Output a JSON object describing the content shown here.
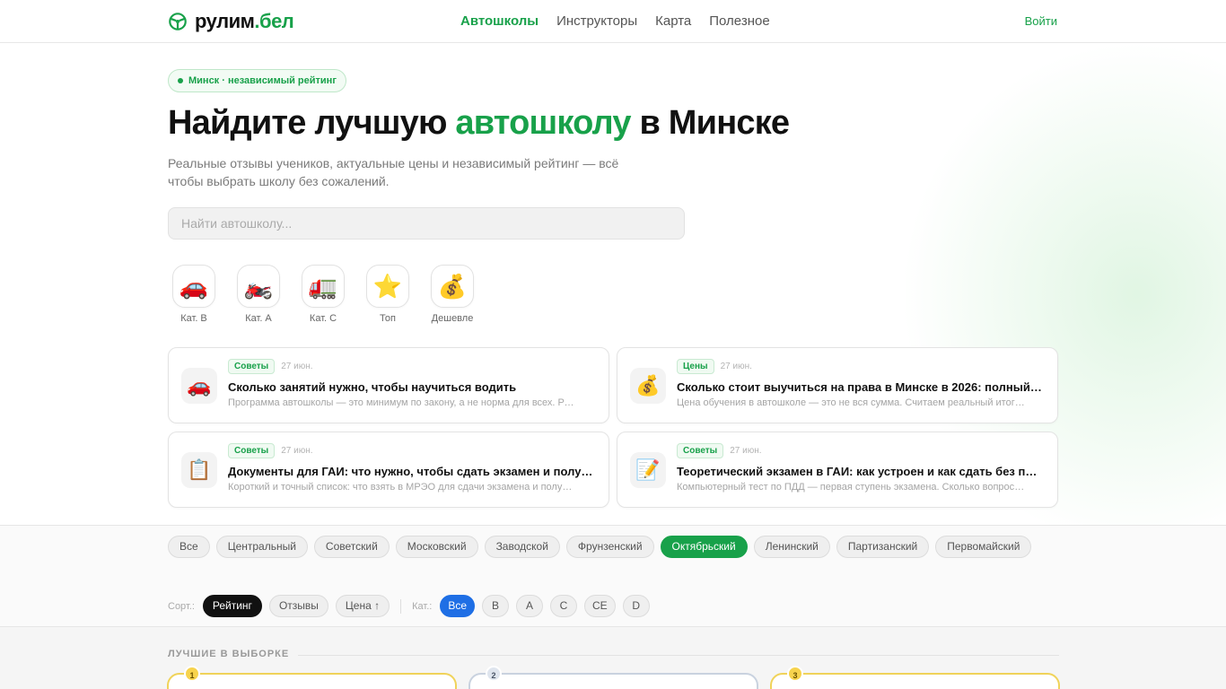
{
  "header": {
    "logo_main": "рулим",
    "logo_accent": ".бел",
    "nav": [
      "Автошколы",
      "Инструкторы",
      "Карта",
      "Полезное"
    ],
    "login": "Войти"
  },
  "hero": {
    "badge": "Минск · независимый рейтинг",
    "title_before": "Найдите лучшую ",
    "title_highlight": "автошколу",
    "title_after": " в Минске",
    "subtitle": "Реальные отзывы учеников, актуальные цены и независимый рейтинг — всё чтобы выбрать школу без сожалений.",
    "search_placeholder": "Найти автошколу..."
  },
  "categories": [
    {
      "icon": "🚗",
      "label": "Кат. B",
      "icon_name": "car-icon"
    },
    {
      "icon": "🏍️",
      "label": "Кат. A",
      "icon_name": "motorcycle-icon"
    },
    {
      "icon": "🚛",
      "label": "Кат. C",
      "icon_name": "truck-icon"
    },
    {
      "icon": "⭐",
      "label": "Топ",
      "icon_name": "star-icon"
    },
    {
      "icon": "💰",
      "label": "Дешевле",
      "icon_name": "money-bag-icon"
    }
  ],
  "articles": [
    {
      "icon": "🚗",
      "tag": "Советы",
      "date": "27 июн.",
      "title": "Сколько занятий нужно, чтобы научиться водить",
      "desc": "Программа автошколы — это минимум по закону, а не норма для всех. Разбираем, сколько"
    },
    {
      "icon": "💰",
      "tag": "Цены",
      "date": "27 июн.",
      "title": "Сколько стоит выучиться на права в Минске в 2026: полный разбор",
      "desc": "Цена обучения в автошколе — это не вся сумма. Считаем реальный итог со всеми расходами"
    },
    {
      "icon": "📋",
      "tag": "Советы",
      "date": "27 июн.",
      "title": "Документы для ГАИ: что нужно, чтобы сдать экзамен и получить права",
      "desc": "Короткий и точный список: что взять в МРЭО для сдачи экзамена и получения прав"
    },
    {
      "icon": "📝",
      "tag": "Советы",
      "date": "27 июн.",
      "title": "Теоретический экзамен в ГАИ: как устроен и как сдать без пересдач",
      "desc": "Компьютерный тест по ПДД — первая ступень экзамена. Сколько вопросов и ошибок допустимо"
    }
  ],
  "districts": [
    "Все",
    "Центральный",
    "Советский",
    "Московский",
    "Заводской",
    "Фрунзенский",
    "Октябрьский",
    "Ленинский",
    "Партизанский",
    "Первомайский"
  ],
  "active_district": "Октябрьский",
  "sort": {
    "label": "Сорт.:",
    "options": [
      "Рейтинг",
      "Отзывы",
      "Цена ↑"
    ],
    "active": "Рейтинг",
    "cat_label": "Кат.:",
    "cat_options": [
      "Все",
      "B",
      "A",
      "C",
      "CE",
      "D"
    ],
    "cat_active": "Все"
  },
  "best": {
    "heading": "ЛУЧШИЕ В ВЫБОРКЕ",
    "ranks": [
      "1",
      "2",
      "3"
    ]
  },
  "colors": {
    "accent": "#18a14a",
    "blue": "#1f6fe5",
    "gold": "#f0d35a",
    "silver": "#c9d2df"
  }
}
